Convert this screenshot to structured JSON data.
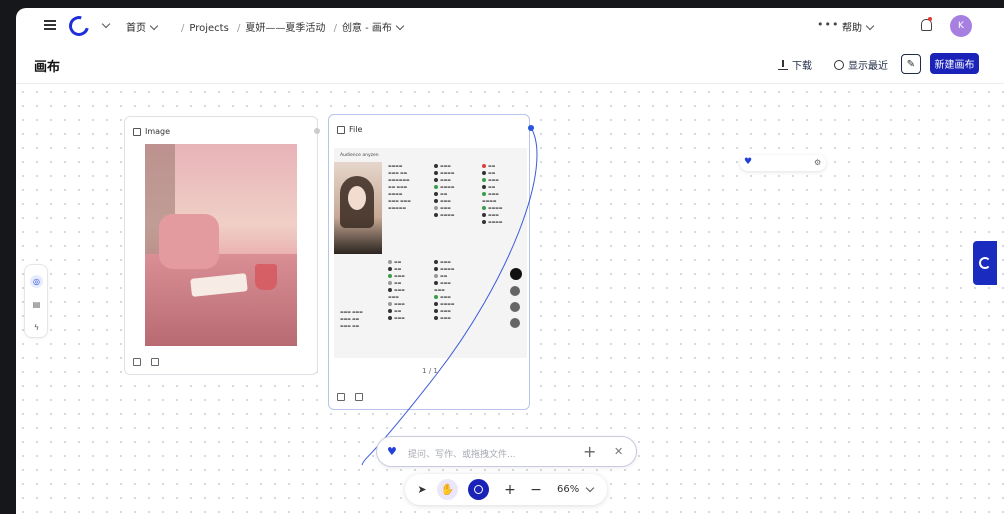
{
  "nav": {
    "home": "首页",
    "crumbs": [
      "Projects",
      "夏妍——夏季活动",
      "创意 - 画布"
    ],
    "more": "•••",
    "help": "帮助",
    "avatar": "K"
  },
  "header": {
    "title": "画布",
    "download": "下载",
    "recent": "显示最近",
    "new_canvas": "新建画布"
  },
  "colors": {
    "brand": "#1a22b8",
    "avatar": "#a77fe0",
    "accent_soft": "#ece6fb"
  },
  "icons": [
    "menu-icon",
    "logo-icon",
    "chevron-down-icon",
    "bell-icon",
    "download-icon",
    "clock-icon",
    "pin-icon",
    "chat-icon",
    "document-icon",
    "lightning-icon",
    "cursor-icon",
    "hand-icon",
    "target-icon",
    "plus-icon",
    "minus-icon",
    "close-icon",
    "bird-icon",
    "trash-icon"
  ],
  "image_node": {
    "title": "Image"
  },
  "file_node": {
    "title": "File",
    "doc_heading": "Audience anyzen",
    "pager": "1 / 1"
  },
  "prompt": {
    "placeholder": "提问、写作、或拖拽文件..."
  },
  "toolbar": {
    "zoom": "66%",
    "plus": "+",
    "minus": "−"
  }
}
